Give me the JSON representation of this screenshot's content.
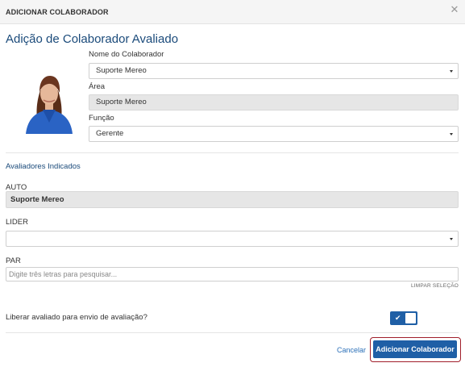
{
  "modal": {
    "title": "ADICIONAR COLABORADOR",
    "close_icon": "close-icon"
  },
  "page_title": "Adição de Colaborador Avaliado",
  "colaborador": {
    "nome_label": "Nome do Colaborador",
    "nome_value": "Suporte Mereo",
    "area_label": "Área",
    "area_value": "Suporte Mereo",
    "funcao_label": "Função",
    "funcao_value": "Gerente"
  },
  "avaliadores": {
    "section_title": "Avaliadores Indicados",
    "auto_label": "AUTO",
    "auto_value": "Suporte Mereo",
    "lider_label": "LIDER",
    "lider_value": "",
    "par_label": "PAR",
    "par_placeholder": "Digite três letras para pesquisar...",
    "clear_label": "LIMPAR SELEÇÃO"
  },
  "liberar": {
    "label": "Liberar avaliado para envio de avaliação?",
    "enabled": true
  },
  "footer": {
    "cancel_label": "Cancelar",
    "submit_label": "Adicionar Colaborador"
  },
  "colors": {
    "primary": "#1f5fa6",
    "title": "#1a4a7a",
    "highlight_border": "#a11f2b"
  }
}
